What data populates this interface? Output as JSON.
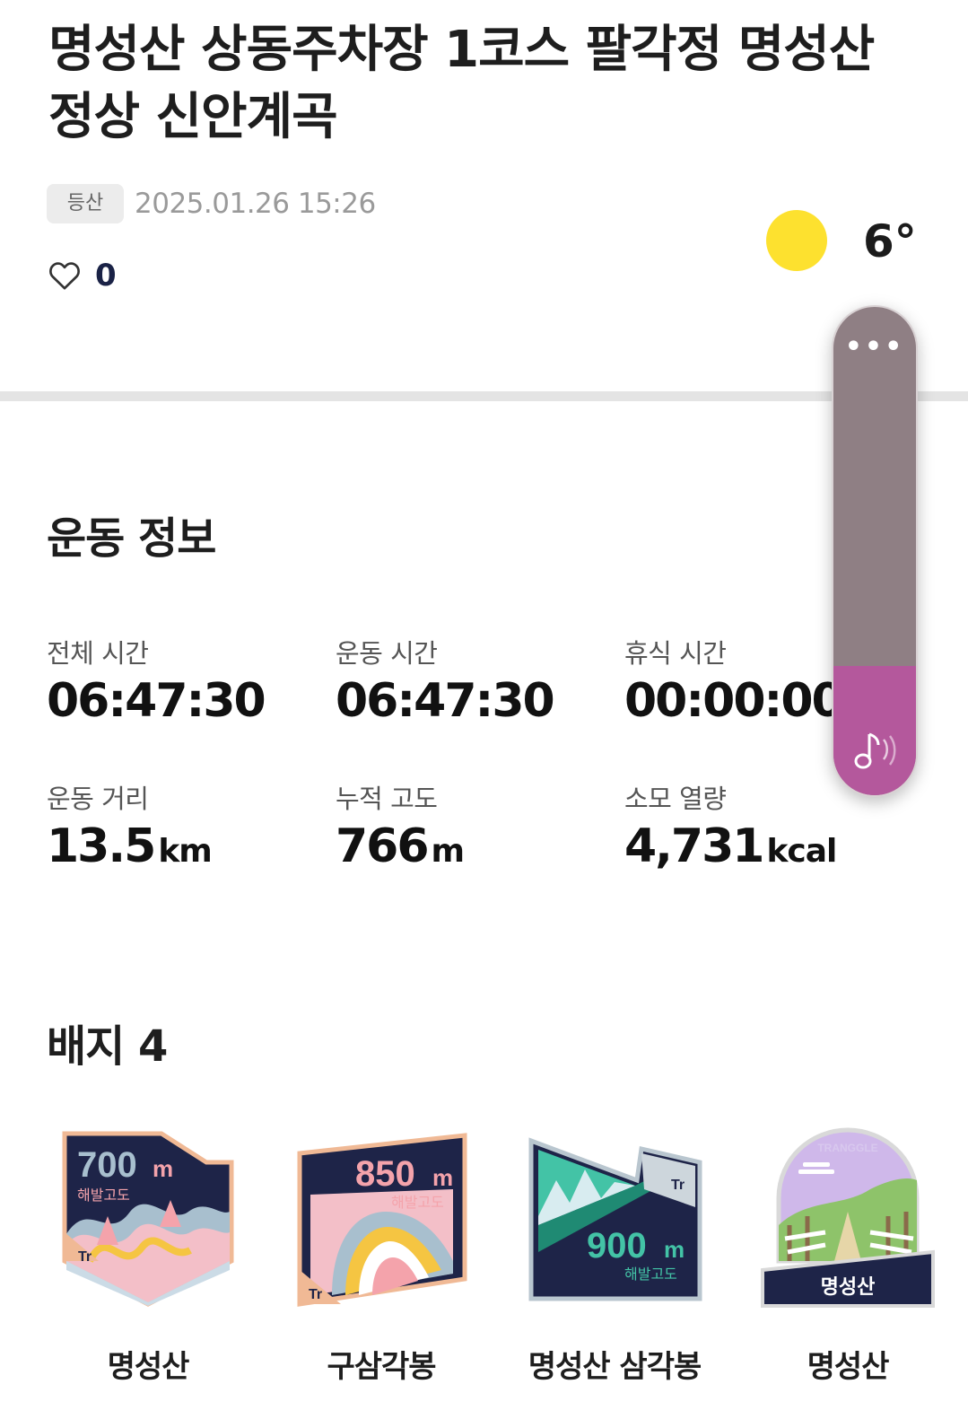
{
  "post": {
    "title": "명성산 상동주차장 1코스 팔각정 명성산 정상 신안계곡",
    "category": "등산",
    "datetime": "2025.01.26 15:26",
    "likes": "0"
  },
  "weather": {
    "icon": "sun-icon",
    "temperature": "6°",
    "color": "#fde12f"
  },
  "floating_menu": {
    "more_label": "•••",
    "music_icon": "music-note-icon",
    "accent": "#b4589c"
  },
  "exercise": {
    "title": "운동 정보",
    "stats": [
      {
        "label": "전체 시간",
        "value": "06:47:30",
        "unit": ""
      },
      {
        "label": "운동 시간",
        "value": "06:47:30",
        "unit": ""
      },
      {
        "label": "휴식 시간",
        "value": "00:00:00",
        "unit": ""
      },
      {
        "label": "운동 거리",
        "value": "13.5",
        "unit": "km"
      },
      {
        "label": "누적 고도",
        "value": "766",
        "unit": "m"
      },
      {
        "label": "소모 열량",
        "value": "4,731",
        "unit": "kcal"
      }
    ]
  },
  "badges": {
    "title": "배지 4",
    "items": [
      {
        "name": "명성산",
        "altitude": "700",
        "unit": "m",
        "caption": "해발고도"
      },
      {
        "name": "구삼각봉",
        "altitude": "850",
        "unit": "m",
        "caption": "해발고도"
      },
      {
        "name": "명성산 삼각봉",
        "altitude": "900",
        "unit": "m",
        "caption": "해발고도"
      },
      {
        "name": "명성산",
        "brand": "TRANGGLE",
        "label": "명성산"
      }
    ]
  }
}
